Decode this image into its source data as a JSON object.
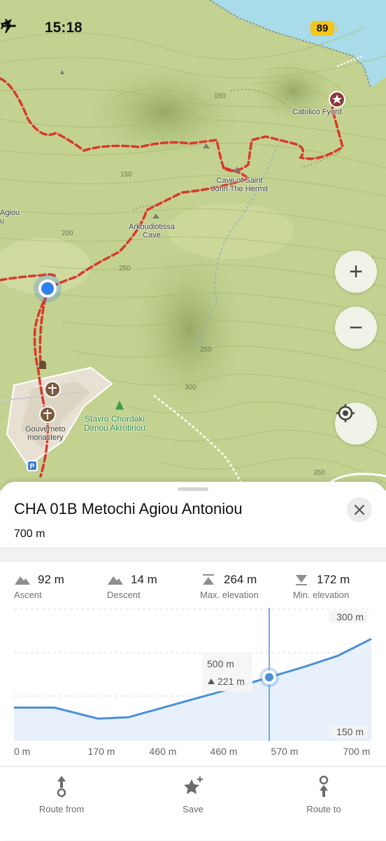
{
  "status_bar": {
    "time": "15:18",
    "battery": "89"
  },
  "map": {
    "labels": {
      "catolico": "Catolico Fyord",
      "cave_saint_1": "Cave of Saint",
      "cave_saint_2": "John The Hermit",
      "arkoudiotissa_1": "Arkoudiotissa",
      "arkoudiotissa_2": "Cave",
      "agiou_1": "Agiou",
      "agiou_2": "u",
      "stavro_1": "Stavro Chordaki",
      "stavro_2": "Dimou Akrotiriou",
      "gouverneto_1": "Gouverneto",
      "gouverneto_2": "monastery",
      "parking": "P"
    },
    "contours": [
      "150",
      "150",
      "200",
      "250",
      "250",
      "300",
      "350"
    ],
    "controls": {
      "zoom_in": "+",
      "zoom_out": "−"
    }
  },
  "sheet": {
    "title": "CHA 01B Metochi Agiou Antoniou",
    "distance": "700 m",
    "stats": [
      {
        "value": "92 m",
        "label": "Ascent",
        "icon": "ascent-icon"
      },
      {
        "value": "14 m",
        "label": "Descent",
        "icon": "descent-icon"
      },
      {
        "value": "264 m",
        "label": "Max. elevation",
        "icon": "max-elevation-icon"
      },
      {
        "value": "172 m",
        "label": "Min. elevation",
        "icon": "min-elevation-icon"
      }
    ]
  },
  "chart_data": {
    "type": "area",
    "x": [
      0,
      60,
      125,
      170,
      300,
      360,
      430,
      480,
      530
    ],
    "y": [
      185,
      185,
      170,
      172,
      205,
      221,
      240,
      255,
      278
    ],
    "ylabels": [
      "300 m",
      "150 m"
    ],
    "xlabels": [
      "0 m",
      "170 m",
      "460 m",
      "460 m",
      "570 m",
      "700 m"
    ],
    "cursor": {
      "distance": "500 m",
      "elevation": "221 m"
    },
    "line_color": "#4a90d9",
    "fill_color": "#e7f0fb"
  },
  "toolbar": {
    "route_from": "Route from",
    "save": "Save",
    "route_to": "Route to"
  },
  "colors": {
    "map_base": "#c3d291",
    "trail": "#d9382d",
    "accent": "#2f80ed"
  }
}
